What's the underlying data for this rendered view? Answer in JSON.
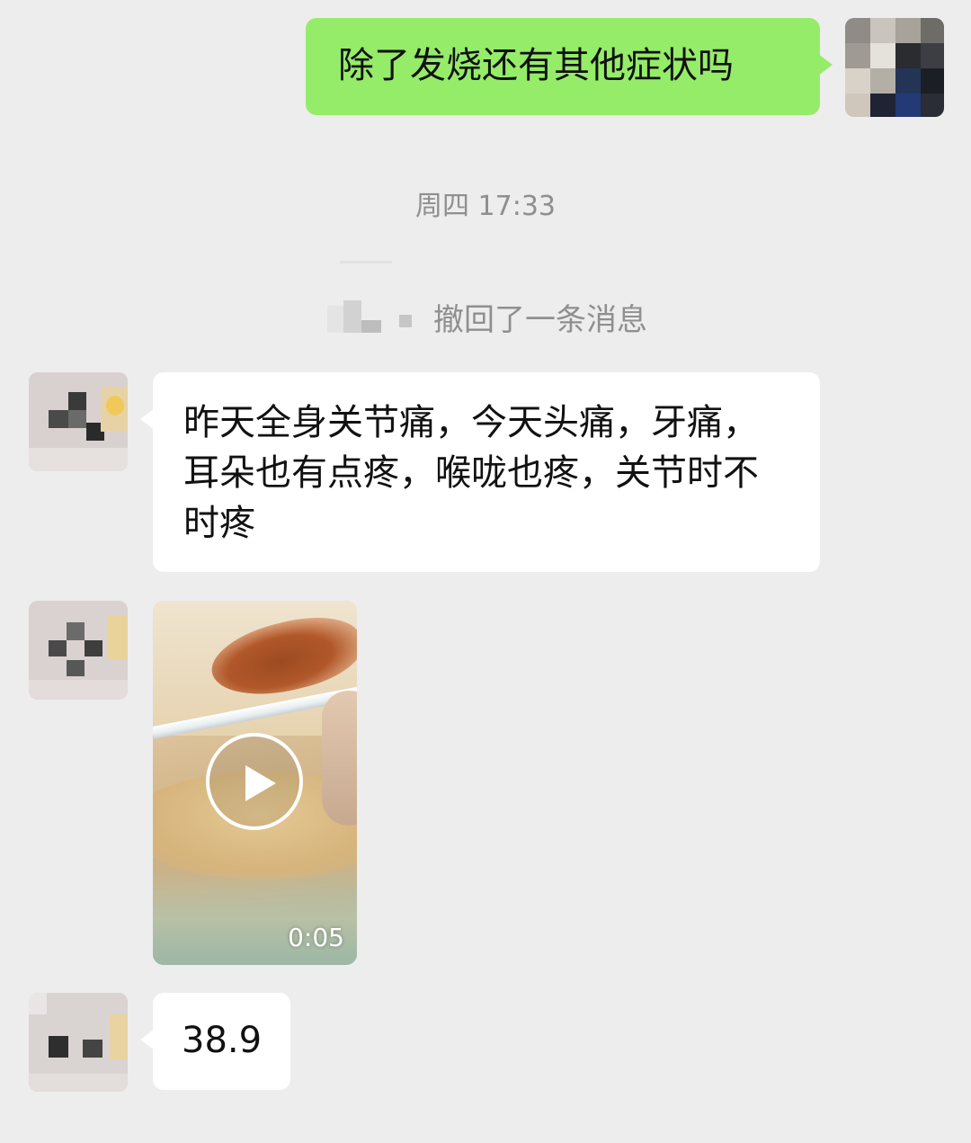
{
  "chat": {
    "messages": [
      {
        "sender": "self",
        "type": "text",
        "text": "除了发烧还有其他症状吗"
      },
      {
        "type": "timestamp",
        "text": "周四 17:33"
      },
      {
        "type": "system",
        "text": "撤回了一条消息"
      },
      {
        "sender": "peer",
        "type": "text",
        "text": "昨天全身关节痛，今天头痛，牙痛，耳朵也有点疼，喉咙也疼，关节时不时疼"
      },
      {
        "sender": "peer",
        "type": "video",
        "duration": "0:05"
      },
      {
        "sender": "peer",
        "type": "text",
        "text": "38.9"
      }
    ]
  },
  "colors": {
    "background": "#ededed",
    "outgoing_bubble": "#95ec69",
    "incoming_bubble": "#ffffff",
    "system_text": "#8f8f8f"
  },
  "icons": {
    "play": "play-icon"
  }
}
